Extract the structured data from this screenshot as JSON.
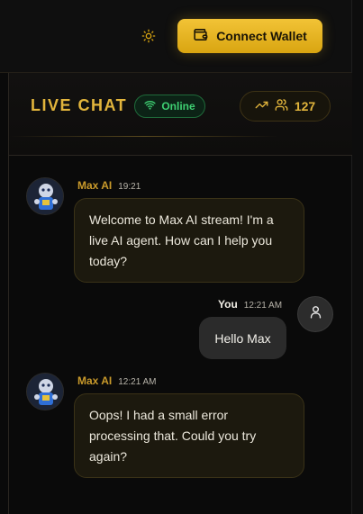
{
  "topbar": {
    "theme_icon": "sun-icon",
    "connect_label": "Connect Wallet",
    "connect_icon": "wallet-icon"
  },
  "chat": {
    "title": "LIVE CHAT",
    "status": "Online",
    "status_icon": "wifi-icon",
    "trend_icon": "trending-up-icon",
    "viewers_icon": "users-icon",
    "viewer_count": "127",
    "colors": {
      "accent_gold": "#e2b53c",
      "online_green": "#3ecf72",
      "ai_bubble": "#1c190e",
      "user_bubble": "#2b2b2b"
    },
    "messages": [
      {
        "sender": "Max AI",
        "time": "19:21",
        "text": "Welcome to Max AI stream! I'm a live AI agent. How can I help you today?"
      },
      {
        "sender": "You",
        "time": "12:21 AM",
        "text": "Hello Max"
      },
      {
        "sender": "Max AI",
        "time": "12:21 AM",
        "text": "Oops! I had a small error processing that. Could you try again?"
      }
    ]
  }
}
